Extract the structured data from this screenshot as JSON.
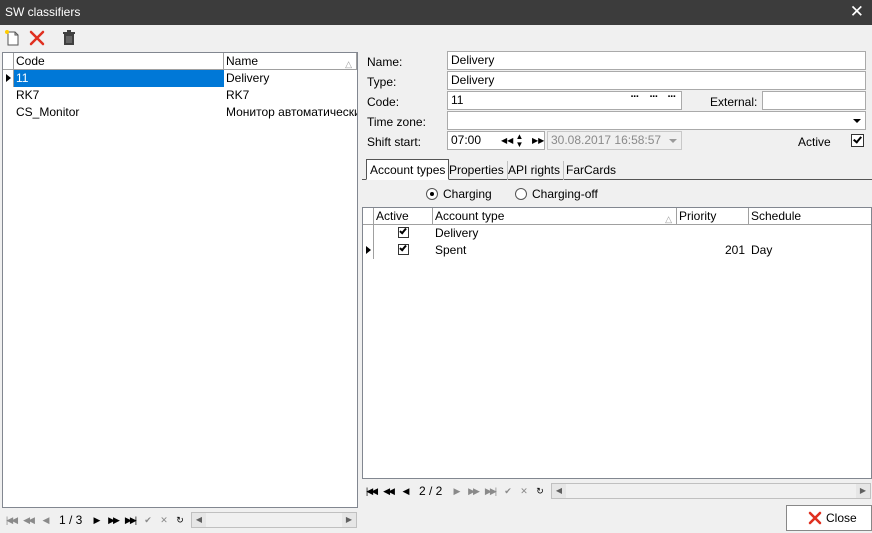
{
  "window": {
    "title": "SW classifiers"
  },
  "toolbar": {
    "new_icon": "new-document-icon",
    "delete_icon": "red-x-icon",
    "trash_icon": "trash-icon"
  },
  "left_grid": {
    "columns": [
      "Code",
      "Name"
    ],
    "rows": [
      {
        "code": "11",
        "name": "Delivery"
      },
      {
        "code": "RK7",
        "name": "RK7"
      },
      {
        "code": "CS_Monitor",
        "name": "Монитор автоматических"
      }
    ],
    "nav_page": "1 / 3"
  },
  "form": {
    "name_label": "Name:",
    "name_value": "Delivery",
    "type_label": "Type:",
    "type_value": "Delivery",
    "code_label": "Code:",
    "code_value": "11",
    "external_label": "External:",
    "external_value": "",
    "timezone_label": "Time zone:",
    "timezone_value": "",
    "shift_label": "Shift start:",
    "shift_time": "07:00",
    "shift_datetime": "30.08.2017 16:58:57",
    "active_label": "Active"
  },
  "tabs": [
    "Account types",
    "Properties",
    "API rights",
    "FarCards"
  ],
  "radios": {
    "charging": "Charging",
    "charging_off": "Charging-off"
  },
  "right_grid": {
    "columns": [
      "Active",
      "Account type",
      "Priority",
      "Schedule"
    ],
    "rows": [
      {
        "account_type": "Delivery",
        "priority": "",
        "schedule": ""
      },
      {
        "account_type": "Spent",
        "priority": "201",
        "schedule": "Day"
      }
    ],
    "nav_page": "2 / 2"
  },
  "buttons": {
    "close": "Close"
  },
  "colors": {
    "titlebar": "#3c3c3c",
    "selection": "#0078d7",
    "delete_red": "#e03020"
  }
}
